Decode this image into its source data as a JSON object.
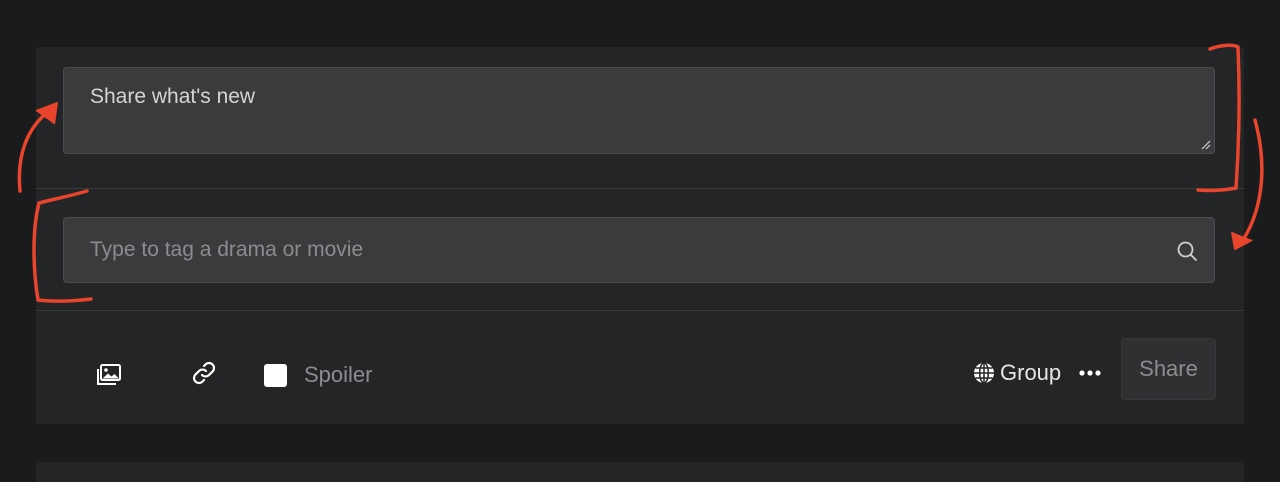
{
  "composer": {
    "text_value": "Share what's new"
  },
  "tag": {
    "placeholder": "Type to tag a drama or movie"
  },
  "toolbar": {
    "spoiler_label": "Spoiler",
    "privacy_label": "Group",
    "share_label": "Share",
    "icons": [
      "image-icon",
      "link-icon",
      "globe-icon",
      "more-icon"
    ]
  },
  "colors": {
    "background": "#1a1b1d",
    "card": "#242527",
    "field": "#3a3b3d",
    "annotation": "#e8452c"
  }
}
